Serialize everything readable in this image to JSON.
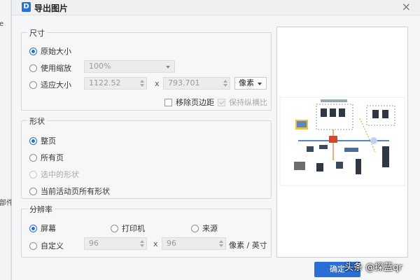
{
  "background": {
    "fragments": [
      "e",
      "部件"
    ]
  },
  "dialog": {
    "icon_glyph": "D",
    "title": "导出图片",
    "close_glyph": "×"
  },
  "size_group": {
    "title": "尺寸",
    "original_label": "原始大小",
    "scale_label": "使用缩放",
    "scale_value": "100%",
    "fit_label": "适应大小",
    "width_value": "1122.52",
    "times": "x",
    "height_value": "793.701",
    "unit_value": "像素",
    "remove_margin_label": "移除页边距",
    "keep_ratio_label": "保持纵横比"
  },
  "shape_group": {
    "title": "形状",
    "whole_page_label": "整页",
    "all_pages_label": "所有页",
    "selected_label": "选中的形状",
    "current_active_label": "当前活动页所有形状"
  },
  "resolution_group": {
    "title": "分辨率",
    "screen_label": "屏幕",
    "printer_label": "打印机",
    "source_label": "来源",
    "custom_label": "自定义",
    "dpi_x": "96",
    "times": "x",
    "dpi_y": "96",
    "unit_label": "像素 / 英寸"
  },
  "buttons": {
    "ok_label": "确定"
  },
  "watermark": "头条 @探蓝qr",
  "colors": {
    "accent": "#2b6fd6"
  }
}
